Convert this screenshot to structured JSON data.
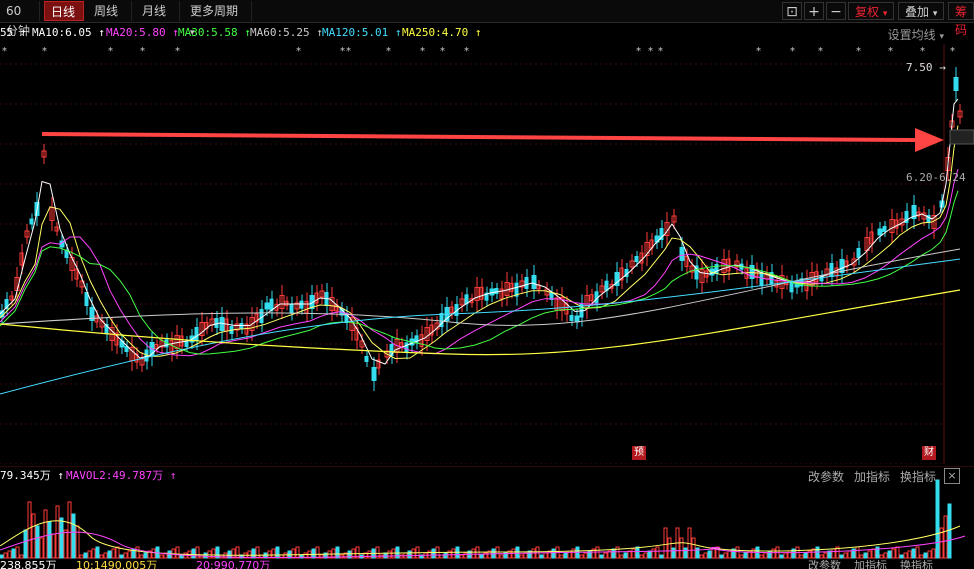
{
  "toolbar": {
    "tabs": [
      "60分钟",
      "日线",
      "周线",
      "月线",
      "更多周期"
    ],
    "active_tab": "日线",
    "icons": [
      "lock-icon",
      "plus-icon",
      "minus-icon"
    ],
    "fuquan_label": "复权",
    "diejia_label": "叠加",
    "chouma_label": "筹码"
  },
  "ma_legend": [
    {
      "text": "55",
      "color": "#ffffff"
    },
    {
      "text": "MA10:6.05",
      "color": "#ffffff"
    },
    {
      "text": "MA20:5.80",
      "color": "#ff44ff"
    },
    {
      "text": "MA30:5.58",
      "color": "#44ff44"
    },
    {
      "text": "MA60:5.25",
      "color": "#cccccc"
    },
    {
      "text": "MA120:5.01",
      "color": "#44ddff"
    },
    {
      "text": "MA250:4.70",
      "color": "#ffff44"
    }
  ],
  "settings_label": "设置均线",
  "price_labels": {
    "high": "7.50",
    "range": "6.20-6.24"
  },
  "markers": {
    "yu": "预",
    "cai": "财"
  },
  "volume": {
    "vol_label": "79.345万",
    "mavol2_label": "MAVOL2:49.787万",
    "buttons": [
      "改参数",
      "加指标",
      "换指标"
    ],
    "close": "×"
  },
  "bottom_row": {
    "left": "238.855万",
    "mid1": "10:1490.005万",
    "mid2": "20:990.770万",
    "right_btns": [
      "改参数",
      "加指标",
      "换指标"
    ]
  },
  "chart_data": {
    "type": "candlestick",
    "ma_values": {
      "MA10": 6.05,
      "MA20": 5.8,
      "MA30": 5.58,
      "MA60": 5.25,
      "MA120": 5.01,
      "MA250": 4.7
    },
    "last_high": 7.5,
    "annotation": "red arrow from left peak pointing to latest rally"
  }
}
